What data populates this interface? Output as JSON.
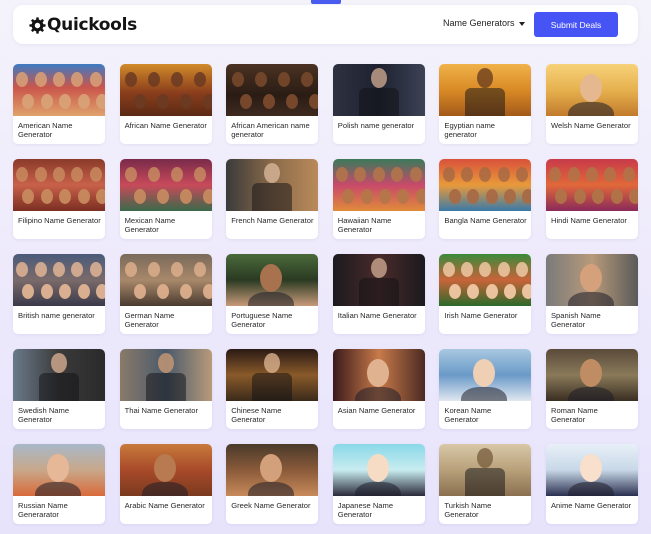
{
  "header": {
    "logo_text": "Quickools",
    "logo_icon": "gear-logo-icon",
    "nav_label": "Name Generators",
    "submit_label": "Submit Deals",
    "accent": "#4653f5"
  },
  "cards": [
    {
      "label": "American Name Generator",
      "bg": "linear-gradient(180deg,#3d7bc4 0%,#c9564b 45%,#e0a36c 100%)",
      "faces": 5,
      "face": "#d9a176"
    },
    {
      "label": "African Name Generator",
      "bg": "linear-gradient(180deg,#d18a2a 0%,#8a3e1c 55%,#5b2a14 100%)",
      "faces": 4,
      "face": "#6b3a22"
    },
    {
      "label": "African American name generator",
      "bg": "linear-gradient(180deg,#4a3222 0%,#2a1c14 60%,#3e2a1f 100%)",
      "faces": 4,
      "face": "#7a4a2c"
    },
    {
      "label": "Polish name generator",
      "bg": "linear-gradient(90deg,#2d3140 0%,#1e2230 50%,#3c4255 100%)",
      "faces": 0,
      "face": "#c9a58d"
    },
    {
      "label": "Egyptian name generator",
      "bg": "linear-gradient(180deg,#f0b24a 0%,#d98a25 50%,#a35a1a 100%)",
      "faces": 0,
      "face": "#6b3e1e"
    },
    {
      "label": "Welsh Name Generator",
      "bg": "linear-gradient(180deg,#f7d27a 0%,#e6b14e 50%,#c27b2c 100%)",
      "faces": 1,
      "face": "#e6b890"
    },
    {
      "label": "Filipino Name Generator",
      "bg": "linear-gradient(180deg,#8a3a2a 0%,#c8614a 50%,#7a2e22 100%)",
      "faces": 5,
      "face": "#c88a5e"
    },
    {
      "label": "Mexican Name Generator",
      "bg": "linear-gradient(180deg,#7a2a4a 0%,#c84a5a 50%,#3a6a4a 100%)",
      "faces": 4,
      "face": "#c58a60"
    },
    {
      "label": "French Name Generator",
      "bg": "linear-gradient(90deg,#3a3a3a 0%,#8a6a4a 50%,#b98a5a 100%)",
      "faces": 0,
      "face": "#d7b59a"
    },
    {
      "label": "Hawaiian Name Generator",
      "bg": "linear-gradient(180deg,#3a7a5a 0%,#c84a6a 50%,#e08a3a 100%)",
      "faces": 5,
      "face": "#b5764a"
    },
    {
      "label": "Bangla Name Generator",
      "bg": "linear-gradient(180deg,#d8523a 0%,#e89a3a 50%,#3a7aa8 100%)",
      "faces": 5,
      "face": "#a86a44"
    },
    {
      "label": "Hindi Name Generator",
      "bg": "linear-gradient(180deg,#c83a4a 0%,#e0683a 50%,#8a2a5a 100%)",
      "faces": 5,
      "face": "#b07448"
    },
    {
      "label": "British name generator",
      "bg": "linear-gradient(180deg,#4a5a7a 0%,#7a6a6a 50%,#3a3a4a 100%)",
      "faces": 5,
      "face": "#e0b494"
    },
    {
      "label": "German Name Generator",
      "bg": "linear-gradient(180deg,#7a6a5a 0%,#a8886a 50%,#4a3a30 100%)",
      "faces": 4,
      "face": "#dcae8c"
    },
    {
      "label": "Portuguese Name Generator",
      "bg": "linear-gradient(180deg,#4a6a3a 0%,#2a3a22 50%,#c89a7a 100%)",
      "faces": 1,
      "face": "#a8724e"
    },
    {
      "label": "Italian Name Generator",
      "bg": "linear-gradient(90deg,#1a1a1e 0%,#4a2a2a 50%,#1a1a1e 100%)",
      "faces": 0,
      "face": "#c9a58d"
    },
    {
      "label": "Irish Name Generator",
      "bg": "linear-gradient(180deg,#3a8a3a 0%,#c8643a 50%,#2a6a2a 100%)",
      "faces": 5,
      "face": "#f0c8a4"
    },
    {
      "label": "Spanish Name Generator",
      "bg": "linear-gradient(90deg,#7a7a7a 0%,#b89a7a 50%,#5a5a5a 100%)",
      "faces": 1,
      "face": "#d5a07c"
    },
    {
      "label": "Swedish Name Generator",
      "bg": "linear-gradient(90deg,#6a7a8a 0%,#3a3a3a 50%,#2a2a2a 100%)",
      "faces": 0,
      "face": "#d6ad90"
    },
    {
      "label": "Thai Name Generator",
      "bg": "linear-gradient(90deg,#8a7a6a 0%,#4a5a6a 50%,#b89a7a 100%)",
      "faces": 0,
      "face": "#c99a74"
    },
    {
      "label": "Chinese Name Generator",
      "bg": "linear-gradient(180deg,#2a1a14 0%,#8a5a2a 50%,#3a2a1a 100%)",
      "faces": 0,
      "face": "#d9b290"
    },
    {
      "label": "Asian Name Generator",
      "bg": "linear-gradient(90deg,#3a1a1a 0%,#c87a4a 50%,#4a2a22 100%)",
      "faces": 1,
      "face": "#e0b290"
    },
    {
      "label": "Korean Name Generator",
      "bg": "linear-gradient(180deg,#a8c8e0 0%,#6a9ac8 50%,#e0e8f0 100%)",
      "faces": 1,
      "face": "#f0d0b4"
    },
    {
      "label": "Roman Name Generator",
      "bg": "linear-gradient(180deg,#5a4a3a 0%,#8a7a5a 50%,#3a2e22 100%)",
      "faces": 1,
      "face": "#c08c64"
    },
    {
      "label": "Russian Name Generarator",
      "bg": "linear-gradient(180deg,#a8b8c8 0%,#c8a88a 50%,#d86a3a 100%)",
      "faces": 1,
      "face": "#e6b898"
    },
    {
      "label": "Arabic Name Generator",
      "bg": "linear-gradient(180deg,#c87a3a 0%,#a84a2a 50%,#7a3a1e 100%)",
      "faces": 1,
      "face": "#b87a50"
    },
    {
      "label": "Greek Name Generator",
      "bg": "linear-gradient(180deg,#4a3a2a 0%,#8a5a3a 50%,#c88a5a 100%)",
      "faces": 1,
      "face": "#d2a07a"
    },
    {
      "label": "Japanese Name Generator",
      "bg": "linear-gradient(180deg,#8ad8e8 0%,#c8ecf0 50%,#2a2a3a 100%)",
      "faces": 1,
      "face": "#f6dcc4"
    },
    {
      "label": "Turkish Name Generator",
      "bg": "linear-gradient(180deg,#d8c8a8 0%,#b8a07a 50%,#8a7050 100%)",
      "faces": 0,
      "face": "#7a6040"
    },
    {
      "label": "Anime Name Generator",
      "bg": "linear-gradient(180deg,#e8f0f8 0%,#c8d8e8 50%,#2a3050 100%)",
      "faces": 1,
      "face": "#f8e0cc"
    }
  ]
}
